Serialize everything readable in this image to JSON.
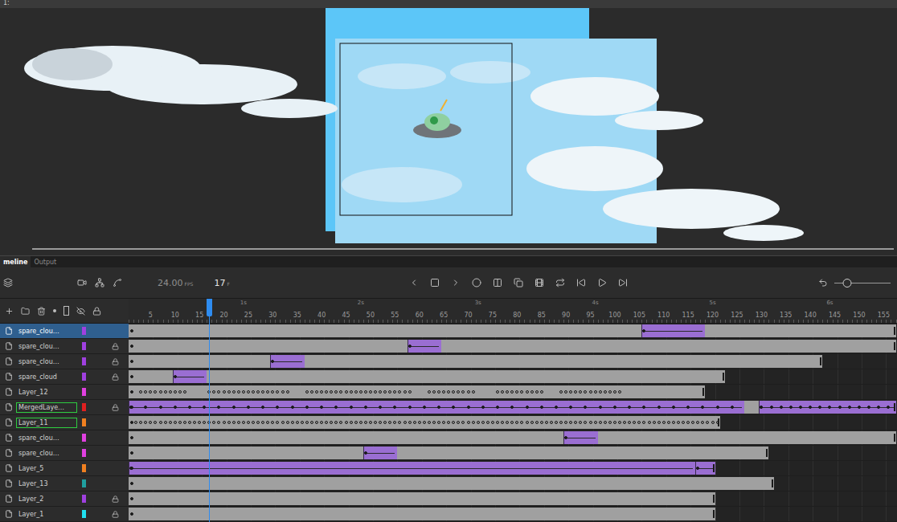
{
  "top_bar": {
    "label": "1:"
  },
  "panel_tabs": [
    {
      "label": "meline",
      "selected": true
    },
    {
      "label": "Output",
      "selected": false
    }
  ],
  "toolbar": {
    "fps": "24.00",
    "fps_unit": "FPS",
    "frame": "17",
    "frame_unit": "F",
    "zoom_level": 0.23
  },
  "ruler": {
    "frame_ticks": [
      "5",
      "10",
      "15",
      "20",
      "25",
      "30",
      "35",
      "40",
      "45",
      "50",
      "55",
      "60",
      "65",
      "70",
      "75",
      "80",
      "85",
      "90",
      "95",
      "100",
      "105",
      "110",
      "115",
      "120",
      "125",
      "130",
      "135",
      "140",
      "145",
      "150",
      "155"
    ],
    "second_labels": [
      {
        "label": "1s",
        "frame": 24
      },
      {
        "label": "2s",
        "frame": 48
      },
      {
        "label": "3s",
        "frame": 72
      },
      {
        "label": "4s",
        "frame": 96
      },
      {
        "label": "5s",
        "frame": 120
      },
      {
        "label": "6s",
        "frame": 144
      }
    ]
  },
  "playhead_frame": 17,
  "layers": [
    {
      "name": "spare_clou…",
      "color": "#a040e0",
      "locked": false,
      "selected": true,
      "annotated": false,
      "end": 157,
      "tweens": [
        [
          106,
          118
        ]
      ],
      "key_runs": []
    },
    {
      "name": "spare_clou…",
      "color": "#a040e0",
      "locked": true,
      "selected": false,
      "annotated": false,
      "end": 157,
      "tweens": [
        [
          58,
          64
        ]
      ],
      "key_runs": []
    },
    {
      "name": "spare_clou…",
      "color": "#a040e0",
      "locked": true,
      "selected": false,
      "annotated": false,
      "end": 142,
      "tweens": [
        [
          30,
          36
        ]
      ],
      "key_runs": []
    },
    {
      "name": "spare_cloud",
      "color": "#a040e0",
      "locked": true,
      "selected": false,
      "annotated": false,
      "end": 122,
      "tweens": [
        [
          10,
          16
        ]
      ],
      "key_runs": []
    },
    {
      "name": "Layer_12",
      "color": "#e040e0",
      "locked": false,
      "selected": false,
      "annotated": false,
      "end": 118,
      "tweens": [],
      "key_runs": [
        {
          "from": 3,
          "to": 12,
          "every": 1
        },
        {
          "from": 17,
          "to": 33,
          "every": 1
        },
        {
          "from": 37,
          "to": 58,
          "every": 1
        },
        {
          "from": 62,
          "to": 71,
          "every": 1
        },
        {
          "from": 76,
          "to": 85,
          "every": 1
        },
        {
          "from": 89,
          "to": 101,
          "every": 1
        }
      ]
    },
    {
      "name": "MergedLaye…",
      "color": "#e02020",
      "locked": true,
      "selected": false,
      "annotated": true,
      "end": 157,
      "tweens": [
        [
          1,
          126
        ],
        [
          130,
          157
        ]
      ],
      "key_runs": [
        {
          "from": 1,
          "to": 126,
          "every": 3
        },
        {
          "from": 130,
          "to": 157,
          "every": 2
        }
      ]
    },
    {
      "name": "Layer_11",
      "color": "#f08020",
      "locked": false,
      "selected": false,
      "annotated": true,
      "end": 121,
      "tweens": [],
      "key_runs": [
        {
          "from": 2,
          "to": 121,
          "every": 1
        }
      ]
    },
    {
      "name": "spare_clou…",
      "color": "#e040e0",
      "locked": false,
      "selected": false,
      "annotated": false,
      "end": 157,
      "tweens": [
        [
          90,
          96
        ]
      ],
      "key_runs": []
    },
    {
      "name": "spare_clou…",
      "color": "#e040e0",
      "locked": false,
      "selected": false,
      "annotated": false,
      "end": 131,
      "tweens": [
        [
          49,
          55
        ]
      ],
      "key_runs": []
    },
    {
      "name": "Layer_5",
      "color": "#f08020",
      "locked": false,
      "selected": false,
      "annotated": false,
      "end": 120,
      "tweens": [
        [
          1,
          116
        ],
        [
          117,
          120
        ]
      ],
      "key_runs": []
    },
    {
      "name": "Layer_13",
      "color": "#20a0a0",
      "locked": false,
      "selected": false,
      "annotated": false,
      "end": 132,
      "tweens": [],
      "key_runs": []
    },
    {
      "name": "Layer_2",
      "color": "#a040e0",
      "locked": true,
      "selected": false,
      "annotated": false,
      "end": 120,
      "tweens": [],
      "key_runs": []
    },
    {
      "name": "Layer_1",
      "color": "#20e0f0",
      "locked": true,
      "selected": false,
      "annotated": false,
      "end": 120,
      "tweens": [],
      "key_runs": []
    }
  ]
}
